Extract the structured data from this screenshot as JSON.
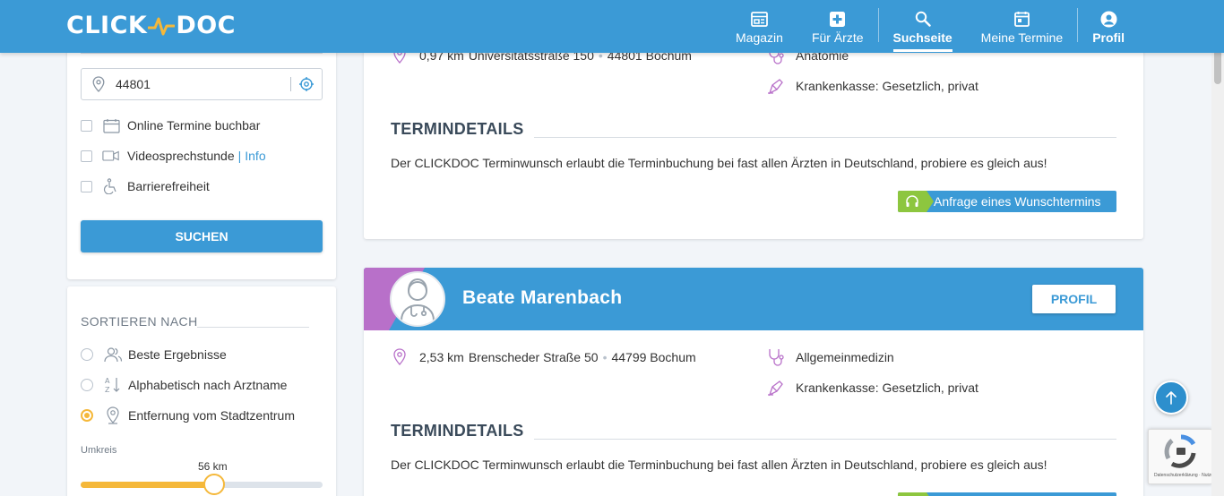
{
  "header": {
    "logo_left": "CLICK",
    "logo_right": "DOC",
    "nav": [
      {
        "label": "Magazin",
        "icon": "newspaper-icon"
      },
      {
        "label": "Für Ärzte",
        "icon": "medical-cross-icon"
      },
      {
        "label": "Suchseite",
        "icon": "search-icon",
        "active": true
      },
      {
        "label": "Meine Termine",
        "icon": "calendar-icon"
      },
      {
        "label": "Profil",
        "icon": "user-circle-icon"
      }
    ]
  },
  "filters": {
    "location_value": "44801",
    "options": [
      {
        "label": "Online Termine buchbar",
        "icon": "calendar-icon"
      },
      {
        "label": "Videosprechstunde",
        "icon": "video-camera-icon",
        "separator": "|",
        "link": "Info"
      },
      {
        "label": "Barrierefreiheit",
        "icon": "wheelchair-icon"
      }
    ],
    "search_button": "SUCHEN"
  },
  "sort": {
    "title": "SORTIEREN NACH",
    "options": [
      {
        "label": "Beste Ergebnisse",
        "icon": "users-icon"
      },
      {
        "label": "Alphabetisch nach Arztname",
        "icon": "sort-alpha-icon"
      },
      {
        "label": "Entfernung vom Stadtzentrum",
        "icon": "map-pin-icon",
        "selected": true
      }
    ],
    "radius_label": "Umkreis",
    "radius_value": "56 km",
    "radius_fraction": 0.55
  },
  "results": [
    {
      "distance": "0,97 km",
      "address": "Universitätsstraße 150",
      "zip_city": "44801 Bochum",
      "specialty": "Anatomie",
      "insurance": "Krankenkasse: Gesetzlich, privat",
      "details_title": "TERMINDETAILS",
      "details_text": "Der CLICKDOC Terminwunsch erlaubt die Terminbuchung bei fast allen Ärzten in Deutschland, probiere es gleich aus!",
      "request_button": "Anfrage eines Wunschtermins"
    },
    {
      "name": "Beate Marenbach",
      "profile_button": "PROFIL",
      "distance": "2,53 km",
      "address": "Brenscheder Straße 50",
      "zip_city": "44799 Bochum",
      "specialty": "Allgemeinmedizin",
      "insurance": "Krankenkasse: Gesetzlich, privat",
      "details_title": "TERMINDETAILS",
      "details_text": "Der CLICKDOC Terminwunsch erlaubt die Terminbuchung bei fast allen Ärzten in Deutschland, probiere es gleich aus!"
    }
  ],
  "colors": {
    "primary": "#3b9ad6",
    "accent_orange": "#f5b83a",
    "accent_purple": "#b870c9",
    "accent_green": "#8dc63f"
  }
}
